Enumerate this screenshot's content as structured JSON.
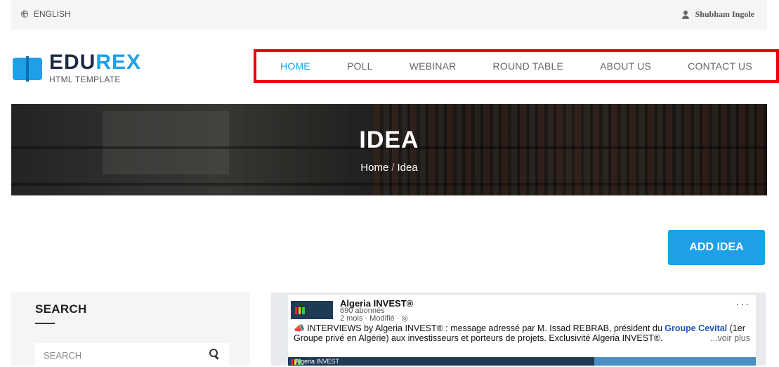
{
  "topbar": {
    "language": "ENGLISH",
    "user_name": "Shubham Ingole"
  },
  "logo": {
    "brand_dark": "EDU",
    "brand_accent": "REX",
    "tagline": "HTML TEMPLATE"
  },
  "nav": {
    "items": [
      {
        "label": "HOME",
        "active": true
      },
      {
        "label": "POLL",
        "active": false
      },
      {
        "label": "WEBINAR",
        "active": false
      },
      {
        "label": "ROUND TABLE",
        "active": false
      },
      {
        "label": "ABOUT US",
        "active": false
      },
      {
        "label": "CONTACT US",
        "active": false
      }
    ]
  },
  "banner": {
    "title": "IDEA",
    "breadcrumb_home": "Home",
    "breadcrumb_sep": "/",
    "breadcrumb_current": "Idea"
  },
  "actions": {
    "add_idea": "ADD IDEA"
  },
  "sidebar": {
    "search_heading": "SEARCH",
    "search_placeholder": "SEARCH"
  },
  "post": {
    "page_name": "Algeria INVEST®",
    "followers": "690 abonnés",
    "time": "2 mois · Modifié · ",
    "dots": "···",
    "text_1": "INTERVIEWS by Algeria INVEST® : message adressé par M. Issad REBRAB, président du ",
    "text_link": "Groupe Cevital",
    "text_2": " (1er Groupe privé en Algérie) aux investisseurs et porteurs de projets. Exclusivité Algeria INVEST®.",
    "voir_plus": "...voir plus",
    "media_label": "Algeria INVEST"
  },
  "colors": {
    "accent": "#1ea0e8",
    "nav_highlight": "#e8000b",
    "brand_dark": "#1f2a44"
  }
}
